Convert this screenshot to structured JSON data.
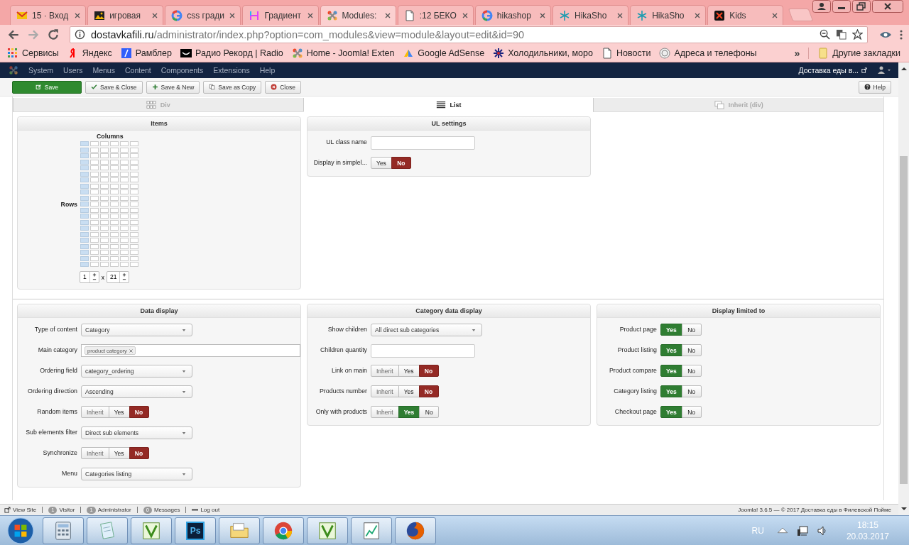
{
  "browser": {
    "tabs": [
      {
        "title": "15 · Вход",
        "selected": false
      },
      {
        "title": "игровая",
        "selected": false
      },
      {
        "title": "css гради",
        "selected": false
      },
      {
        "title": "Градиент",
        "selected": false
      },
      {
        "title": "Modules:",
        "selected": true
      },
      {
        "title": ":12 БЕКО",
        "selected": false
      },
      {
        "title": "hikashop",
        "selected": false
      },
      {
        "title": "HikaSho",
        "selected": false
      },
      {
        "title": "HikaSho",
        "selected": false
      },
      {
        "title": "Kids",
        "selected": false
      }
    ],
    "address": {
      "domain": "dostavkafili.ru",
      "path": "/administrator/index.php?option=com_modules&view=module&layout=edit&id=90"
    },
    "bookmarks": [
      "Сервисы",
      "Яндекс",
      "Рамблер",
      "Радио Рекорд | Radio",
      "Home - Joomla! Exten",
      "Google AdSense",
      "Холодильники, моро",
      "Новости",
      "Адреса и телефоны"
    ],
    "more_bookmarks": "»",
    "other_bookmarks": "Другие закладки"
  },
  "admin_menu": {
    "items": [
      "System",
      "Users",
      "Menus",
      "Content",
      "Components",
      "Extensions",
      "Help"
    ],
    "site": "Доставка еды в..."
  },
  "toolbar": {
    "buttons": [
      {
        "label": "Save",
        "kind": "primary"
      },
      {
        "label": "Save & Close",
        "kind": "default"
      },
      {
        "label": "Save & New",
        "kind": "default"
      },
      {
        "label": "Save as Copy",
        "kind": "default"
      },
      {
        "label": "Close",
        "kind": "default"
      }
    ],
    "help": "Help"
  },
  "layout_tabs": [
    {
      "label": "Div",
      "selected": false
    },
    {
      "label": "List",
      "selected": true
    },
    {
      "label": "Inherit (div)",
      "selected": false
    }
  ],
  "top_panels": [
    {
      "title": "Items",
      "kind": "grid",
      "columns_label": "Columns",
      "rows_label": "Rows",
      "columns": "1",
      "times": "x",
      "rows": "21"
    },
    {
      "title": "UL settings",
      "kind": "form",
      "fields": [
        {
          "label": "UL class name",
          "kind": "text"
        },
        {
          "label": "Display in simplel...",
          "kind": "toggle",
          "options": [
            {
              "label": "Yes",
              "kind": "yes",
              "selected": false
            },
            {
              "label": "No",
              "kind": "no",
              "selected": true
            }
          ]
        }
      ]
    }
  ],
  "bottom_panels": [
    {
      "title": "Data display",
      "kind": "form",
      "fields": [
        {
          "label": "Type of content",
          "kind": "select",
          "value": "Category"
        },
        {
          "label": "Main category",
          "kind": "tags",
          "tags": [
            "product category"
          ]
        },
        {
          "label": "Ordering field",
          "kind": "select",
          "value": "category_ordering"
        },
        {
          "label": "Ordering direction",
          "kind": "select",
          "value": "Ascending"
        },
        {
          "label": "Random items",
          "kind": "toggle",
          "options": [
            {
              "label": "Inherit",
              "kind": "inherit",
              "selected": false
            },
            {
              "label": "Yes",
              "kind": "yes",
              "selected": false
            },
            {
              "label": "No",
              "kind": "no",
              "selected": true
            }
          ]
        },
        {
          "label": "Sub elements filter",
          "kind": "select",
          "value": "Direct sub elements"
        },
        {
          "label": "Synchronize",
          "kind": "toggle",
          "options": [
            {
              "label": "Inherit",
              "kind": "inherit",
              "selected": false
            },
            {
              "label": "Yes",
              "kind": "yes",
              "selected": false
            },
            {
              "label": "No",
              "kind": "no",
              "selected": true
            }
          ]
        },
        {
          "label": "Menu",
          "kind": "select",
          "value": "Categories listing"
        }
      ]
    },
    {
      "title": "Category data display",
      "kind": "form",
      "fields": [
        {
          "label": "Show children",
          "kind": "select",
          "value": "All direct sub categories"
        },
        {
          "label": "Children quantity",
          "kind": "text"
        },
        {
          "label": "Link on main",
          "kind": "toggle",
          "options": [
            {
              "label": "Inherit",
              "kind": "inherit",
              "selected": false
            },
            {
              "label": "Yes",
              "kind": "yes",
              "selected": false
            },
            {
              "label": "No",
              "kind": "no",
              "selected": true
            }
          ]
        },
        {
          "label": "Products number",
          "kind": "toggle",
          "options": [
            {
              "label": "Inherit",
              "kind": "inherit",
              "selected": false
            },
            {
              "label": "Yes",
              "kind": "yes",
              "selected": false
            },
            {
              "label": "No",
              "kind": "no",
              "selected": true
            }
          ]
        },
        {
          "label": "Only with products",
          "kind": "toggle",
          "options": [
            {
              "label": "Inherit",
              "kind": "inherit",
              "selected": false
            },
            {
              "label": "Yes",
              "kind": "yes",
              "selected": true
            },
            {
              "label": "No",
              "kind": "no",
              "selected": false
            }
          ]
        }
      ]
    },
    {
      "title": "Display limited to",
      "kind": "form",
      "fields": [
        {
          "label": "Product page",
          "kind": "toggle",
          "options": [
            {
              "label": "Yes",
              "kind": "yes",
              "selected": true
            },
            {
              "label": "No",
              "kind": "no",
              "selected": false
            }
          ]
        },
        {
          "label": "Product listing",
          "kind": "toggle",
          "options": [
            {
              "label": "Yes",
              "kind": "yes",
              "selected": true
            },
            {
              "label": "No",
              "kind": "no",
              "selected": false
            }
          ]
        },
        {
          "label": "Product compare",
          "kind": "toggle",
          "options": [
            {
              "label": "Yes",
              "kind": "yes",
              "selected": true
            },
            {
              "label": "No",
              "kind": "no",
              "selected": false
            }
          ]
        },
        {
          "label": "Category listing",
          "kind": "toggle",
          "options": [
            {
              "label": "Yes",
              "kind": "yes",
              "selected": true
            },
            {
              "label": "No",
              "kind": "no",
              "selected": false
            }
          ]
        },
        {
          "label": "Checkout page",
          "kind": "toggle",
          "options": [
            {
              "label": "Yes",
              "kind": "yes",
              "selected": true
            },
            {
              "label": "No",
              "kind": "no",
              "selected": false
            }
          ]
        }
      ]
    }
  ],
  "status_bar": {
    "items": [
      {
        "label": "View Site",
        "kind": "link"
      },
      {
        "label": "Visitor",
        "kind": "count",
        "count": "1"
      },
      {
        "label": "Administrator",
        "kind": "count",
        "count": "1"
      },
      {
        "label": "Messages",
        "kind": "count",
        "count": "0"
      },
      {
        "label": "Log out",
        "kind": "logout"
      }
    ],
    "footer": "Joomla! 3.6.5 — © 2017 Доставка еды в Филевской Пойме"
  },
  "taskbar": {
    "photoshop_label": "Ps",
    "language": "RU",
    "time": "18:15",
    "date": "20.03.2017"
  }
}
